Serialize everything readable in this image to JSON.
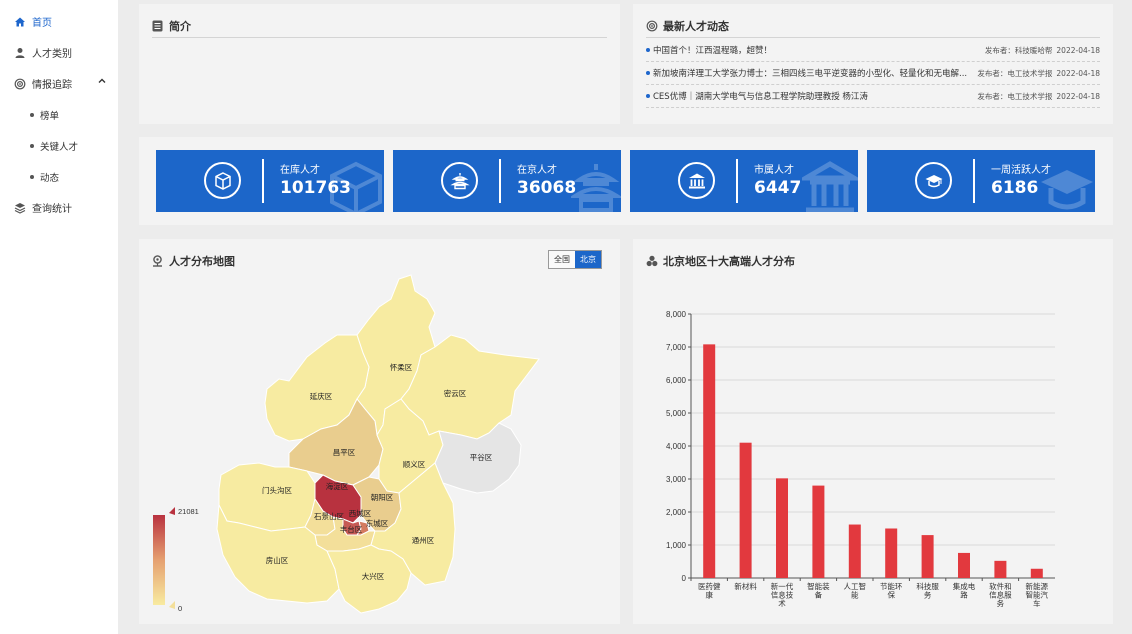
{
  "sidebar": {
    "items": [
      {
        "label": "首页",
        "icon": "home-icon",
        "active": true
      },
      {
        "label": "人才类别",
        "icon": "user-icon"
      },
      {
        "label": "情报追踪",
        "icon": "radar-icon",
        "expanded": true,
        "children": [
          "榜单",
          "关键人才",
          "动态"
        ]
      },
      {
        "label": "查询统计",
        "icon": "stack-icon"
      }
    ]
  },
  "intro": {
    "title": "简介"
  },
  "news": {
    "title": "最新人才动态",
    "items": [
      {
        "title": "中国首个！江西温程璐，超赞！",
        "publisher_label": "发布者：",
        "publisher": "科技暖哈帮",
        "date": "2022-04-18"
      },
      {
        "title": "新加坡南洋理工大学张力博士：三相四线三电平逆变器的小型化、轻量化和无电解...",
        "publisher_label": "发布者：",
        "publisher": "电工技术学报",
        "date": "2022-04-18"
      },
      {
        "title": "CES优博｜湖南大学电气与信息工程学院助理教授 杨江涛",
        "publisher_label": "发布者：",
        "publisher": "电工技术学报",
        "date": "2022-04-18"
      }
    ]
  },
  "stats": [
    {
      "label": "在库人才",
      "value": "101763",
      "icon": "cube-icon"
    },
    {
      "label": "在京人才",
      "value": "36068",
      "icon": "temple-icon"
    },
    {
      "label": "市属人才",
      "value": "6447",
      "icon": "bank-icon"
    },
    {
      "label": "一周活跃人才",
      "value": "6186",
      "icon": "graduation-cap-icon"
    }
  ],
  "map": {
    "title": "人才分布地图",
    "toggle": [
      "全国",
      "北京"
    ],
    "toggle_selected": "北京",
    "legend_max": "21081",
    "legend_min": "0",
    "districts": [
      "怀柔区",
      "延庆区",
      "密云区",
      "昌平区",
      "顺义区",
      "平谷区",
      "门头沟区",
      "海淀区",
      "朝阳区",
      "石景山区",
      "西城区",
      "东城区",
      "丰台区",
      "通州区",
      "房山区",
      "大兴区"
    ],
    "colors": {
      "high": "#b8323f",
      "mid": "#e5c48a",
      "low": "#f8eba0",
      "none": "#e6e6e6"
    }
  },
  "chart_data": {
    "type": "bar",
    "title": "北京地区十大高端人才分布",
    "categories": [
      "医药健康",
      "新材料",
      "新一代信息技术",
      "智能装备",
      "人工智能",
      "节能环保",
      "科技服务",
      "集成电路",
      "软件和信息服务",
      "新能源智能汽车"
    ],
    "category_lines": [
      [
        "医药健",
        "康"
      ],
      [
        "新材料"
      ],
      [
        "新一代",
        "信息技",
        "术"
      ],
      [
        "智能装",
        "备"
      ],
      [
        "人工智",
        "能"
      ],
      [
        "节能环",
        "保"
      ],
      [
        "科技服",
        "务"
      ],
      [
        "集成电",
        "路"
      ],
      [
        "软件和",
        "信息服",
        "务"
      ],
      [
        "新能源",
        "智能汽",
        "车"
      ]
    ],
    "values": [
      7080,
      4100,
      3020,
      2800,
      1620,
      1500,
      1300,
      760,
      520,
      280
    ],
    "ylim": [
      0,
      8000
    ],
    "yticks": [
      "0",
      "1,000",
      "2,000",
      "3,000",
      "4,000",
      "5,000",
      "6,000",
      "7,000",
      "8,000"
    ],
    "grid": true,
    "color": "#e2393e"
  }
}
